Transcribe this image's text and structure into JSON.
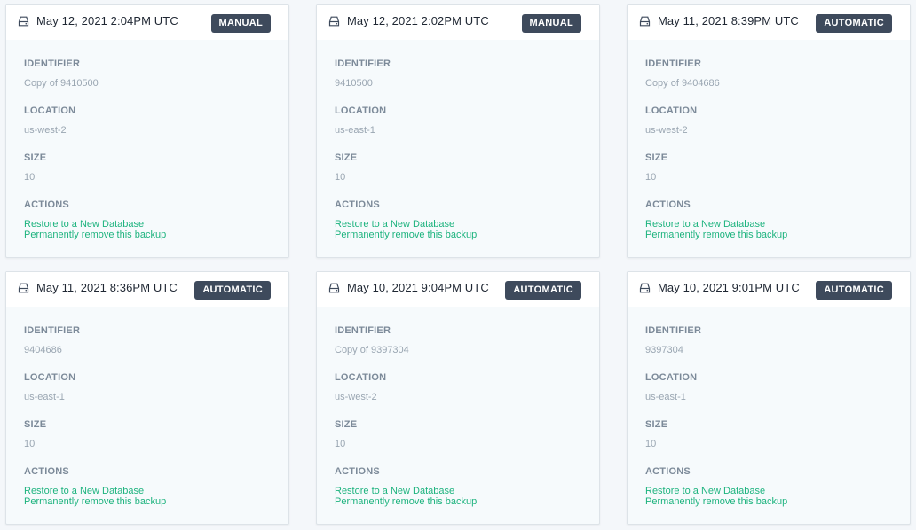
{
  "labels": {
    "identifier": "IDENTIFIER",
    "location": "LOCATION",
    "size": "SIZE",
    "actions": "ACTIONS",
    "restore": "Restore to a New Database",
    "remove": "Permanently remove this backup"
  },
  "icons": {
    "header": "database-disk-icon"
  },
  "colors": {
    "badge_bg": "#3e4a5c",
    "action_link": "#1db37e",
    "page_bg": "#f4f7fa"
  },
  "backups": [
    {
      "date": "May 12, 2021 2:04PM UTC",
      "type": "MANUAL",
      "identifier": "Copy of 9410500",
      "location": "us-west-2",
      "size": "10"
    },
    {
      "date": "May 12, 2021 2:02PM UTC",
      "type": "MANUAL",
      "identifier": "9410500",
      "location": "us-east-1",
      "size": "10"
    },
    {
      "date": "May 11, 2021 8:39PM UTC",
      "type": "AUTOMATIC",
      "identifier": "Copy of 9404686",
      "location": "us-west-2",
      "size": "10"
    },
    {
      "date": "May 11, 2021 8:36PM UTC",
      "type": "AUTOMATIC",
      "identifier": "9404686",
      "location": "us-east-1",
      "size": "10"
    },
    {
      "date": "May 10, 2021 9:04PM UTC",
      "type": "AUTOMATIC",
      "identifier": "Copy of 9397304",
      "location": "us-west-2",
      "size": "10"
    },
    {
      "date": "May 10, 2021 9:01PM UTC",
      "type": "AUTOMATIC",
      "identifier": "9397304",
      "location": "us-east-1",
      "size": "10"
    }
  ]
}
